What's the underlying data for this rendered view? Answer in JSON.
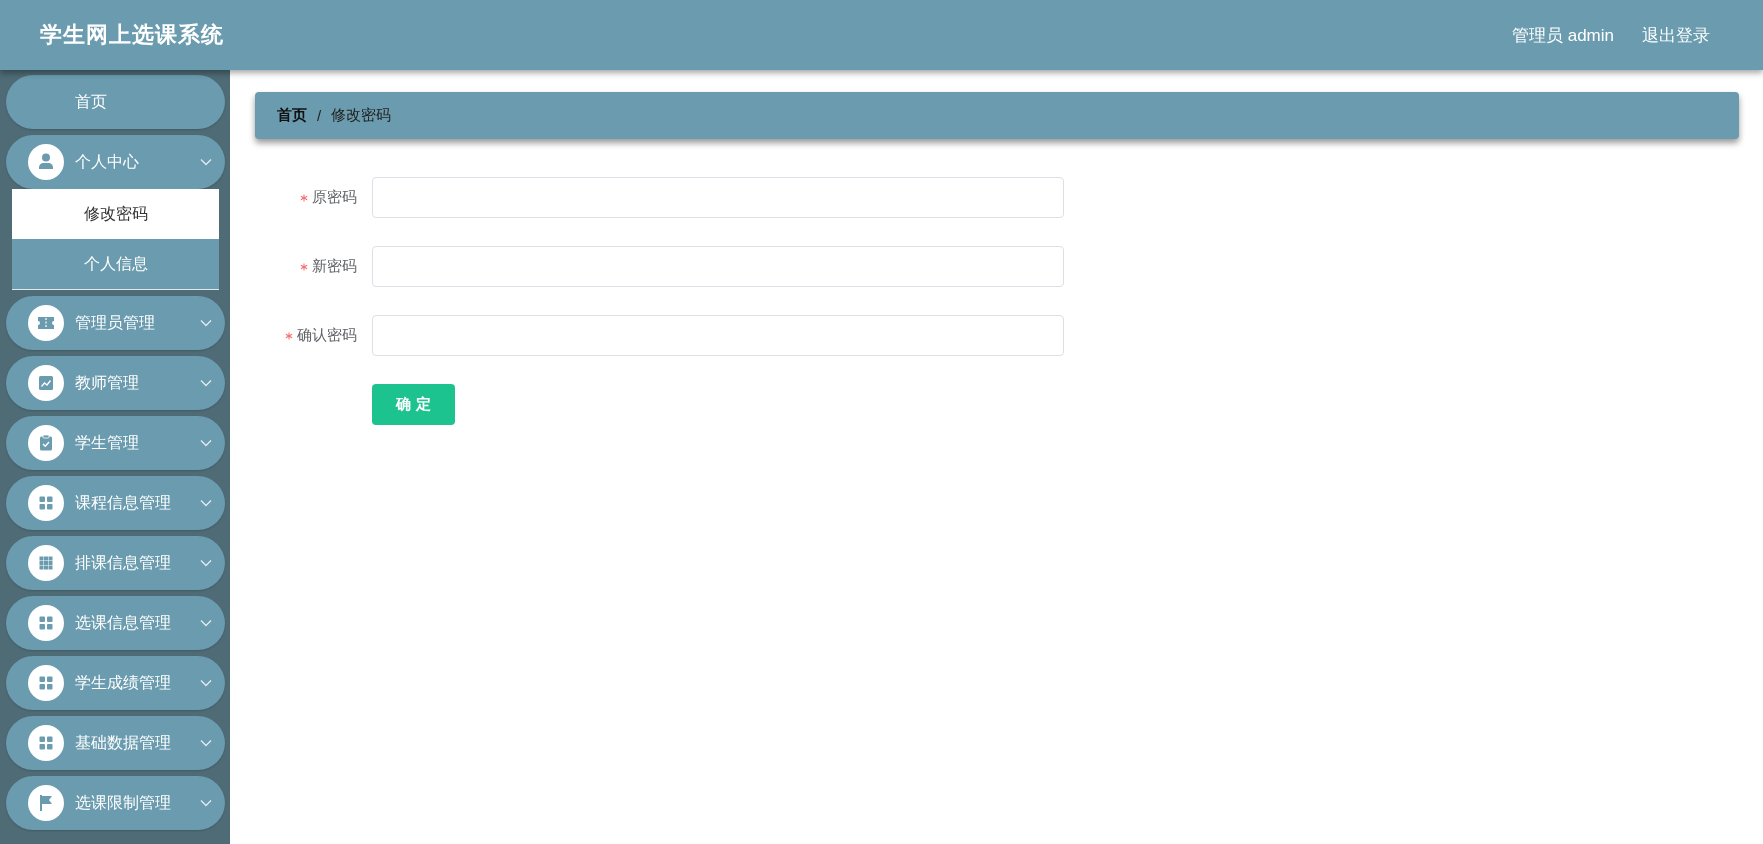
{
  "header": {
    "title": "学生网上选课系统",
    "user": "管理员 admin",
    "logout": "退出登录"
  },
  "sidebar": {
    "items": [
      {
        "label": "首页",
        "kind": "link",
        "selected": false
      },
      {
        "label": "个人中心",
        "kind": "submenu",
        "selected": false,
        "children": [
          {
            "label": "修改密码",
            "selected": true
          },
          {
            "label": "个人信息",
            "selected": false
          }
        ]
      },
      {
        "label": "管理员管理",
        "kind": "submenu",
        "selected": false
      },
      {
        "label": "教师管理",
        "kind": "submenu",
        "selected": false
      },
      {
        "label": "学生管理",
        "kind": "submenu",
        "selected": false
      },
      {
        "label": "课程信息管理",
        "kind": "submenu",
        "selected": false
      },
      {
        "label": "排课信息管理",
        "kind": "submenu",
        "selected": false
      },
      {
        "label": "选课信息管理",
        "kind": "submenu",
        "selected": false
      },
      {
        "label": "学生成绩管理",
        "kind": "submenu",
        "selected": false
      },
      {
        "label": "基础数据管理",
        "kind": "submenu",
        "selected": false
      },
      {
        "label": "选课限制管理",
        "kind": "submenu",
        "selected": false
      }
    ]
  },
  "breadcrumb": {
    "items": [
      "首页",
      "修改密码"
    ],
    "separator": "/"
  },
  "form": {
    "fields": [
      {
        "label": "原密码",
        "required": true
      },
      {
        "label": "新密码",
        "required": true
      },
      {
        "label": "确认密码",
        "required": true
      }
    ],
    "submit": "确 定"
  }
}
